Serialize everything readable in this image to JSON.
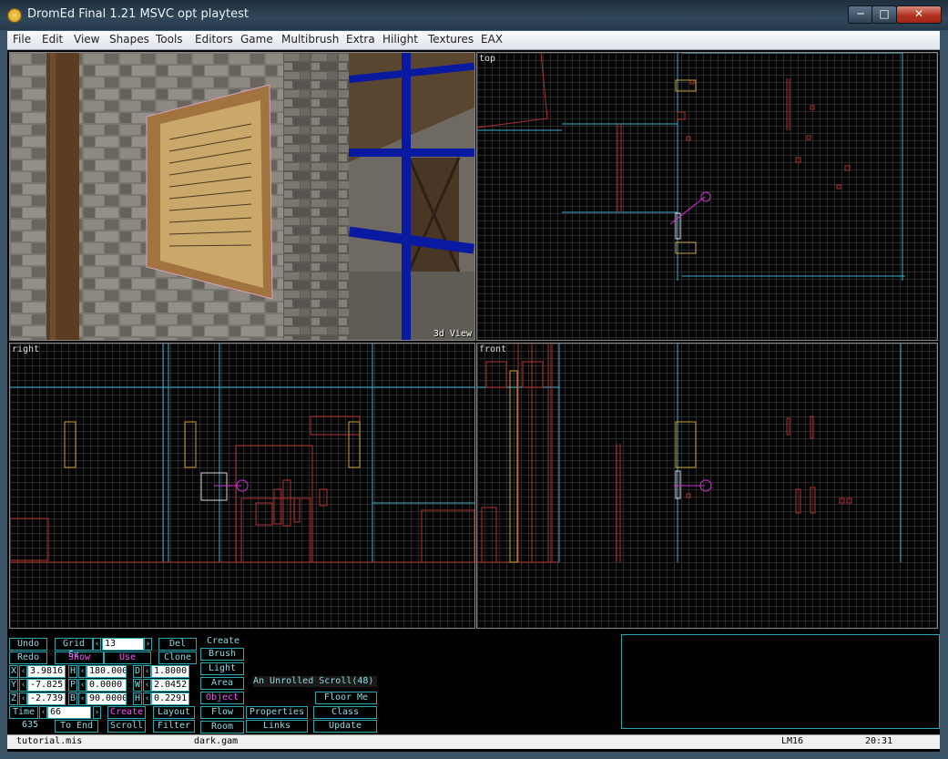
{
  "window": {
    "title": "DromEd Final 1.21 MSVC opt playtest"
  },
  "menu": [
    "File",
    "Edit",
    "View",
    "Shapes",
    "Tools",
    "Editors",
    "Game",
    "Multibrush",
    "Extra",
    "Hilight",
    "Textures",
    "EAX"
  ],
  "viewports": {
    "view3d": "3d View",
    "top": "top",
    "right": "right",
    "front": "front"
  },
  "controls": {
    "undo": "Undo",
    "redo": "Redo",
    "grid_size_label": "Grid Sz",
    "grid_size_value": "13",
    "delete": "Del",
    "create_brush_top": "Create",
    "create_brush_bottom": "Brush",
    "show": "Show",
    "use": "Use",
    "clone": "Clone",
    "light": "Light",
    "area": "Area",
    "object": "Object",
    "flow": "Flow",
    "room": "Room",
    "x_label": "X",
    "x_value": "3.9816",
    "h_label": "H",
    "h_value": "180.000",
    "dx_label": "D",
    "dx_value": "1.8000",
    "y_label": "Y",
    "y_value": "-7.825",
    "p_label": "P",
    "p_value": "0.0000",
    "dy_label": "W",
    "dy_value": "2.0452",
    "z_label": "Z",
    "z_value": "-2.739",
    "b_label": "B",
    "b_value": "90.0000",
    "dz_label": "H",
    "dz_value": "0.2291",
    "time_label": "Time",
    "time_value": "66",
    "brush_count": "635",
    "to_end": "To End",
    "create": "Create",
    "scroll": "Scroll",
    "layout": "Layout",
    "filter": "Filter",
    "selected_name": "An Unrolled Scroll(48)",
    "floor_me": "Floor Me",
    "properties": "Properties",
    "class": "Class",
    "links": "Links",
    "update": "Update"
  },
  "status": {
    "mission": "tutorial.mis",
    "gamesys": "dark.gam",
    "lightmap": "LM16",
    "time": "20:31"
  }
}
